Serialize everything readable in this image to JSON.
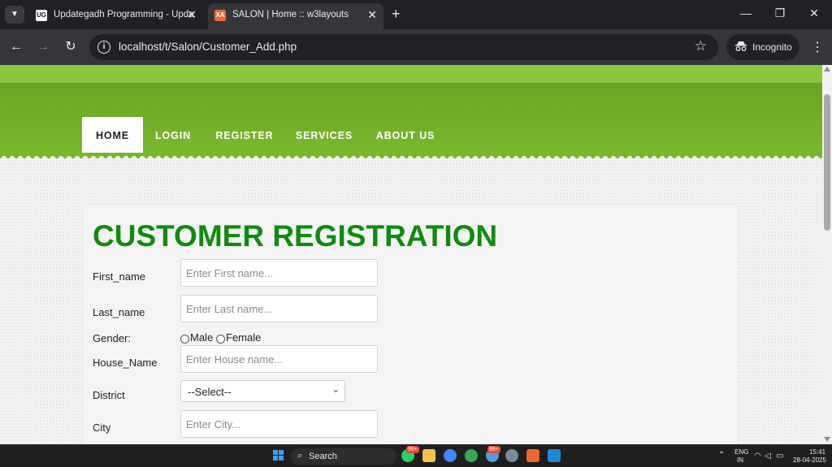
{
  "browser": {
    "tabs": [
      {
        "favicon": "UG",
        "title": "Updategadh Programming - Upda"
      },
      {
        "favicon": "XA",
        "title": "SALON | Home :: w3layouts"
      }
    ],
    "url": "localhost/t/Salon/Customer_Add.php",
    "incognito_label": "Incognito",
    "icons": {
      "tab_menu": "chevron-down-icon",
      "new_tab": "+",
      "minimize": "—",
      "restore": "❐",
      "close": "✕",
      "back": "←",
      "forward": "→",
      "reload": "↻",
      "info": "i",
      "star": "☆",
      "kebab": "⋮"
    }
  },
  "site": {
    "colors": {
      "nav_green": "#6aa322",
      "top_green": "#8cc63f",
      "title_green": "#108a10"
    },
    "menu": [
      {
        "label": "HOME",
        "active": true
      },
      {
        "label": "LOGIN",
        "active": false
      },
      {
        "label": "REGISTER",
        "active": false
      },
      {
        "label": "SERVICES",
        "active": false
      },
      {
        "label": "ABOUT US",
        "active": false
      }
    ]
  },
  "form": {
    "title": "CUSTOMER REGISTRATION",
    "fields": {
      "first_name": {
        "label": "First_name",
        "placeholder": "Enter First name..."
      },
      "last_name": {
        "label": "Last_name",
        "placeholder": "Enter Last name..."
      },
      "gender": {
        "label": "Gender:",
        "options": [
          "Male",
          "Female"
        ]
      },
      "house_name": {
        "label": "House_Name",
        "placeholder": "Enter House name..."
      },
      "district": {
        "label": "District",
        "selected": "--Select--"
      },
      "city": {
        "label": "City",
        "placeholder": "Enter City..."
      }
    }
  },
  "taskbar": {
    "search_label": "Search",
    "badges": [
      "99+",
      "99+"
    ],
    "tray": {
      "lang": "ENG",
      "region": "IN",
      "time": "15:41",
      "date": "28-04-2025"
    }
  }
}
